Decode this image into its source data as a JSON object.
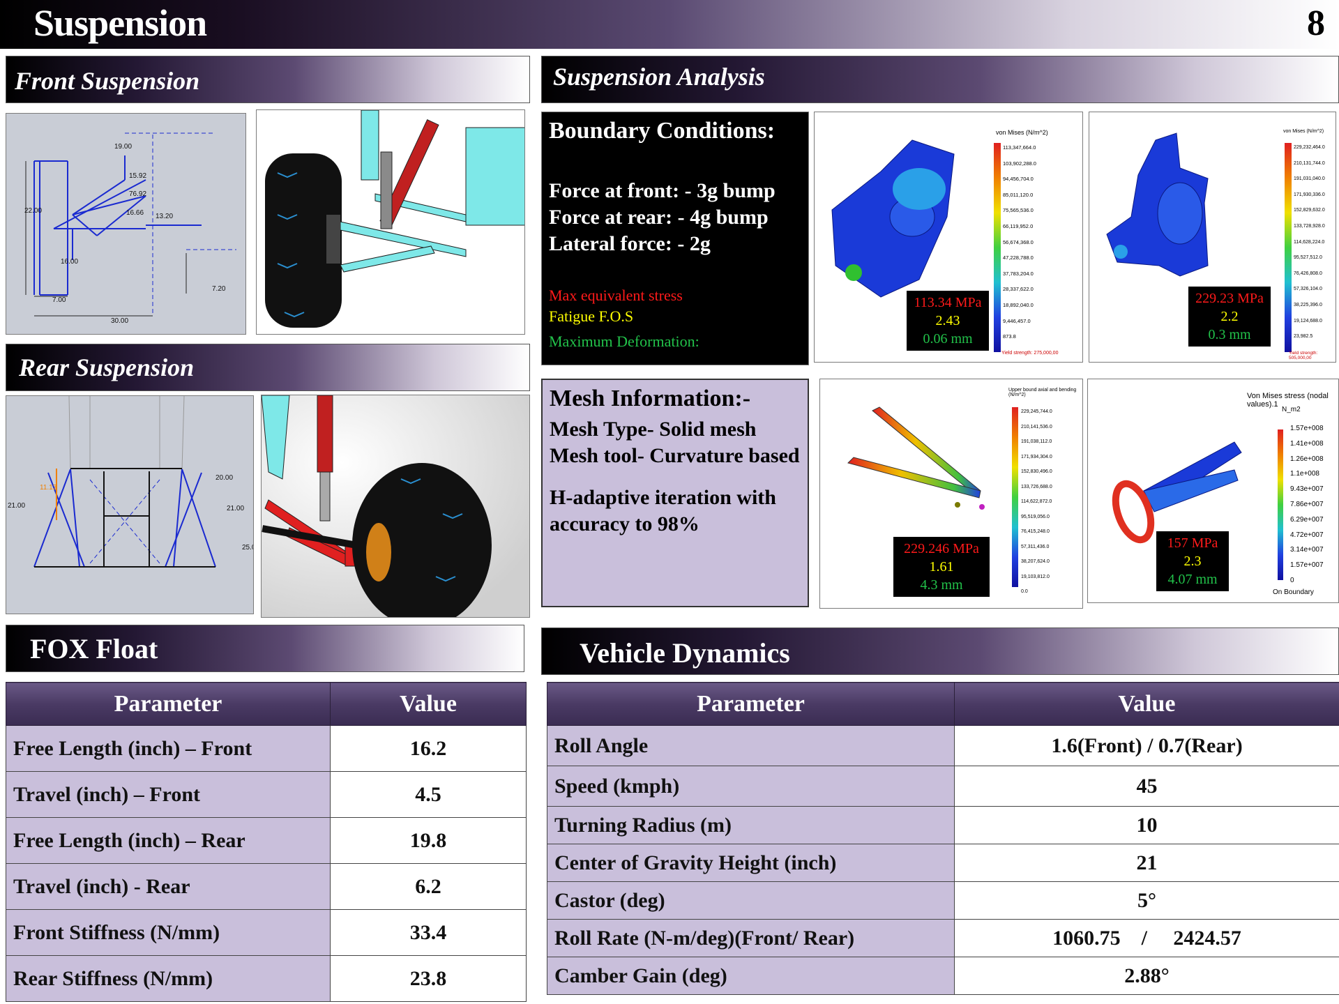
{
  "header": {
    "title": "Suspension",
    "page_number": "8"
  },
  "front": {
    "title": "Front Suspension",
    "dims": [
      "19.00",
      "15.92",
      "76.92",
      "16.66",
      "13.20",
      "22.00",
      "16.00",
      "7.00",
      "30.00",
      "7.20"
    ]
  },
  "rear": {
    "title": "Rear Suspension",
    "dims": [
      "11.13",
      "21.00",
      "21.00",
      "20.00",
      "25.0"
    ]
  },
  "analysis": {
    "title": "Suspension Analysis",
    "boundary_title": "Boundary Conditions:",
    "force_front": "Force at front: - 3g bump",
    "force_rear": "Force at rear: - 4g bump",
    "lateral": "Lateral force: - 2g",
    "legend_stress": "Max equivalent stress",
    "legend_fos": "Fatigue F.O.S",
    "legend_def": "Maximum Deformation:",
    "mesh_title": "Mesh Information:-",
    "mesh_type": "Mesh Type- Solid mesh",
    "mesh_tool": "Mesh tool- Curvature based",
    "mesh_iter": "H-adaptive iteration with accuracy to 98%",
    "results": [
      {
        "stress": "113.34 MPa",
        "fos": "2.43",
        "def": "0.06 mm",
        "scale_title": "von Mises (N/m^2)",
        "scale": [
          "113,347,664.0",
          "103,902,288.0",
          "94,456,704.0",
          "85,011,120.0",
          "75,565,536.0",
          "66,119,952.0",
          "56,674,368.0",
          "47,228,788.0",
          "37,783,204.0",
          "28,337,622.0",
          "18,892,040.0",
          "9,446,457.0",
          "873.8"
        ],
        "yield": "Yield strength: 275,000,00"
      },
      {
        "stress": "229.23 MPa",
        "fos": "2.2",
        "def": "0.3 mm",
        "scale_title": "von Mises (N/m^2)",
        "scale": [
          "229,232,464.0",
          "210,131,744.0",
          "191,031,040.0",
          "171,930,336.0",
          "152,829,632.0",
          "133,728,928.0",
          "114,628,224.0",
          "95,527,512.0",
          "76,426,808.0",
          "57,326,104.0",
          "38,225,396.0",
          "19,124,688.0",
          "23,982.5"
        ],
        "yield": "Yield strength: 505,000,00"
      },
      {
        "stress": "229.246 MPa",
        "fos": "1.61",
        "def": "4.3 mm",
        "scale_title": "Upper bound axial and bending (N/m^2)",
        "scale": [
          "229,245,744.0",
          "210,141,536.0",
          "191,038,112.0",
          "171,934,304.0",
          "152,830,496.0",
          "133,726,688.0",
          "114,622,872.0",
          "95,519,056.0",
          "76,415,248.0",
          "57,311,436.0",
          "38,207,624.0",
          "19,103,812.0",
          "0.0"
        ],
        "yield": ""
      },
      {
        "stress": "157 MPa",
        "fos": "2.3",
        "def": "4.07 mm",
        "scale_title": "Von Mises stress (nodal values).1",
        "unit": "N_m2",
        "scale": [
          "1.57e+008",
          "1.41e+008",
          "1.26e+008",
          "1.1e+008",
          "9.43e+007",
          "7.86e+007",
          "6.29e+007",
          "4.72e+007",
          "3.14e+007",
          "1.57e+007",
          "0"
        ],
        "yield": "On Boundary"
      }
    ]
  },
  "fox": {
    "title": "FOX Float",
    "headers": [
      "Parameter",
      "Value"
    ],
    "rows": [
      [
        "Free Length (inch) – Front",
        "16.2"
      ],
      [
        "Travel (inch) – Front",
        "4.5"
      ],
      [
        "Free Length (inch) – Rear",
        "19.8"
      ],
      [
        "Travel (inch) - Rear",
        "6.2"
      ],
      [
        "Front Stiffness (N/mm)",
        "33.4"
      ],
      [
        "Rear Stiffness (N/mm)",
        "23.8"
      ]
    ]
  },
  "vd": {
    "title": "Vehicle Dynamics",
    "headers": [
      "Parameter",
      "Value"
    ],
    "rows": [
      [
        "Roll Angle",
        "1.6(Front)  / 0.7(Rear)"
      ],
      [
        "Speed (kmph)",
        "45"
      ],
      [
        "Turning Radius (m)",
        "10"
      ],
      [
        "Center of Gravity Height (inch)",
        "21"
      ],
      [
        "Castor (deg)",
        "5°"
      ],
      [
        "Roll Rate (N-m/deg)(Front/ Rear)",
        "1060.75    /     2424.57"
      ],
      [
        "Camber Gain (deg)",
        "2.88°"
      ]
    ]
  },
  "colors": {
    "table_header": "#4a3a64",
    "param_cell": "#c9bfdb",
    "stress": "#ff1a1a",
    "fos": "#ffff00",
    "deformation": "#22c24a"
  }
}
